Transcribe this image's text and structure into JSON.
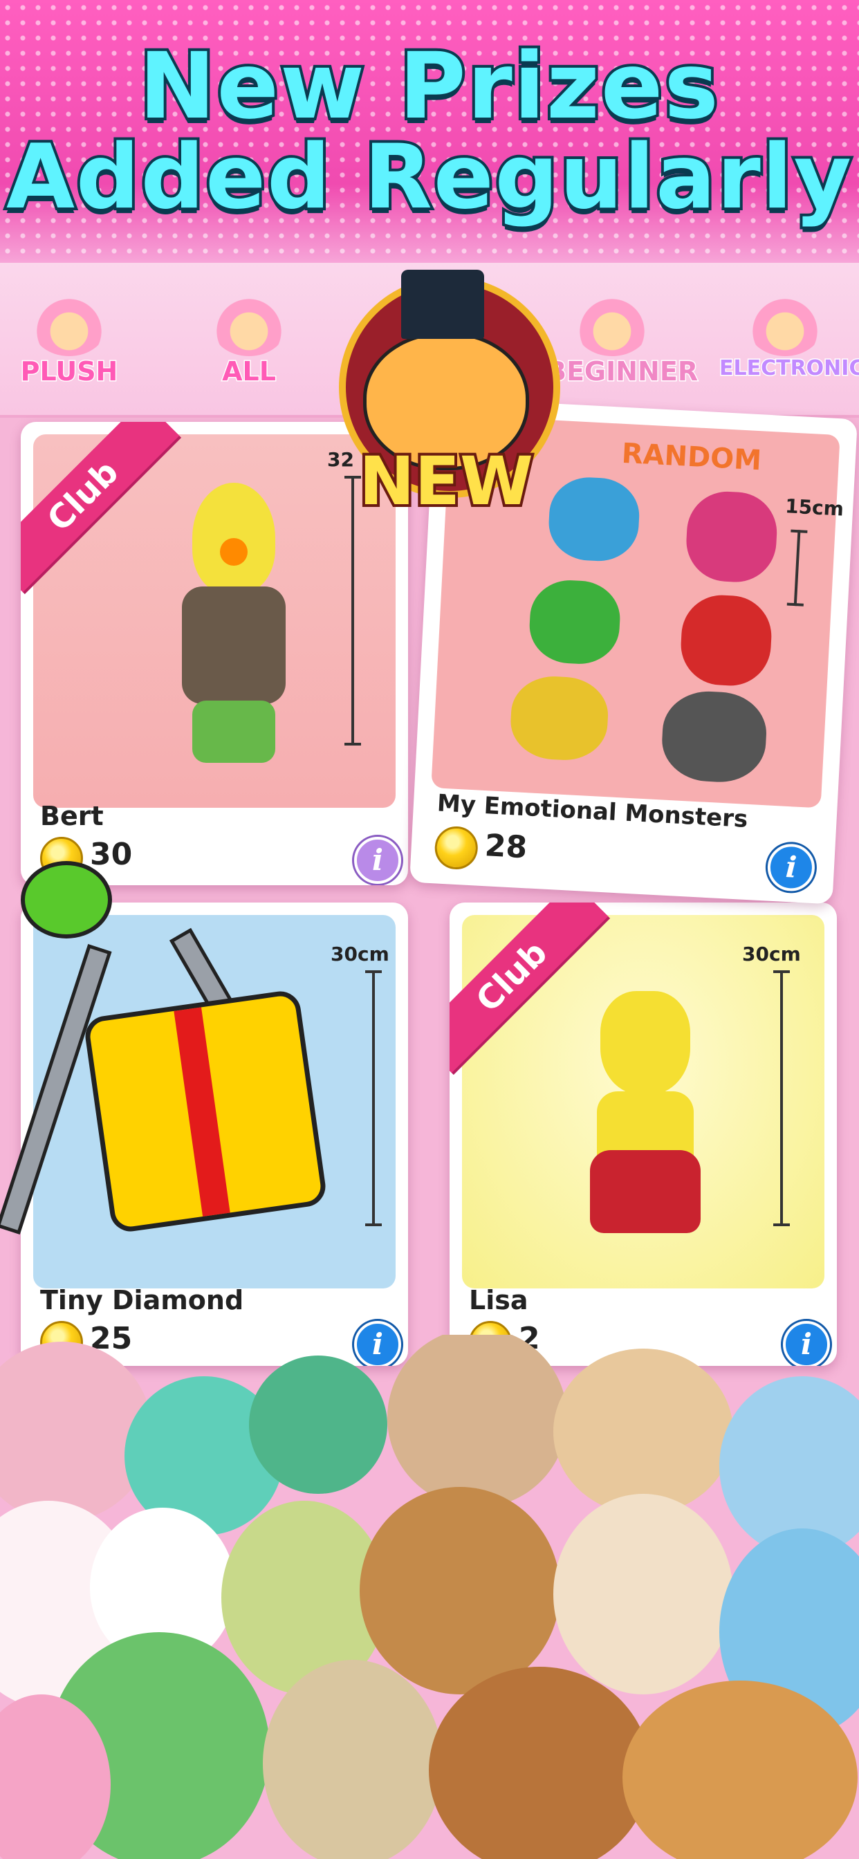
{
  "headline": {
    "line1": "New Prizes",
    "line2": "Added Regularly"
  },
  "categories": [
    {
      "label": "PLUSH"
    },
    {
      "label": "ALL"
    },
    {
      "label": "BEGINNER"
    },
    {
      "label": "ELECTRONIC"
    }
  ],
  "new_badge": "NEW",
  "cards": [
    {
      "name": "Bert",
      "price": "30",
      "ribbon": "Club",
      "size": "32"
    },
    {
      "name": "My Emotional Monsters",
      "price": "28",
      "tag": "RANDOM",
      "size": "15cm"
    },
    {
      "name": "Tiny Diamond",
      "price": "25",
      "size": "30cm"
    },
    {
      "name": "Lisa",
      "price": "2",
      "ribbon": "Club",
      "size": "30cm"
    }
  ],
  "colors": {
    "accent": "#e8337f",
    "headline_fill": "#5ff3ff",
    "info_blue": "#1e86e8"
  }
}
